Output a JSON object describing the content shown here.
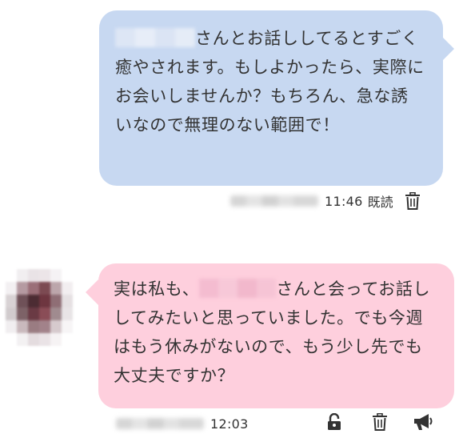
{
  "messages": {
    "outgoing": {
      "text": "さんとお話ししてるとすごく癒やされます。もしよかったら、実際にお会いしませんか？もちろん、急な誘いなので無理のない範囲で！",
      "time": "11:46",
      "status": "既読",
      "icons": [
        "trash-icon"
      ]
    },
    "incoming": {
      "text_before": "実は私も、",
      "text_after": "さんと会ってお話ししてみたいと思っていました。でも今週はもう休みがないので、もう少し先でも大丈夫ですか？",
      "time": "12:03",
      "icons": [
        "unlock-icon",
        "trash-icon",
        "megaphone-icon"
      ]
    }
  },
  "colors": {
    "outgoing_bubble": "#c7d8f1",
    "incoming_bubble": "#fecfdd",
    "text": "#333333"
  }
}
